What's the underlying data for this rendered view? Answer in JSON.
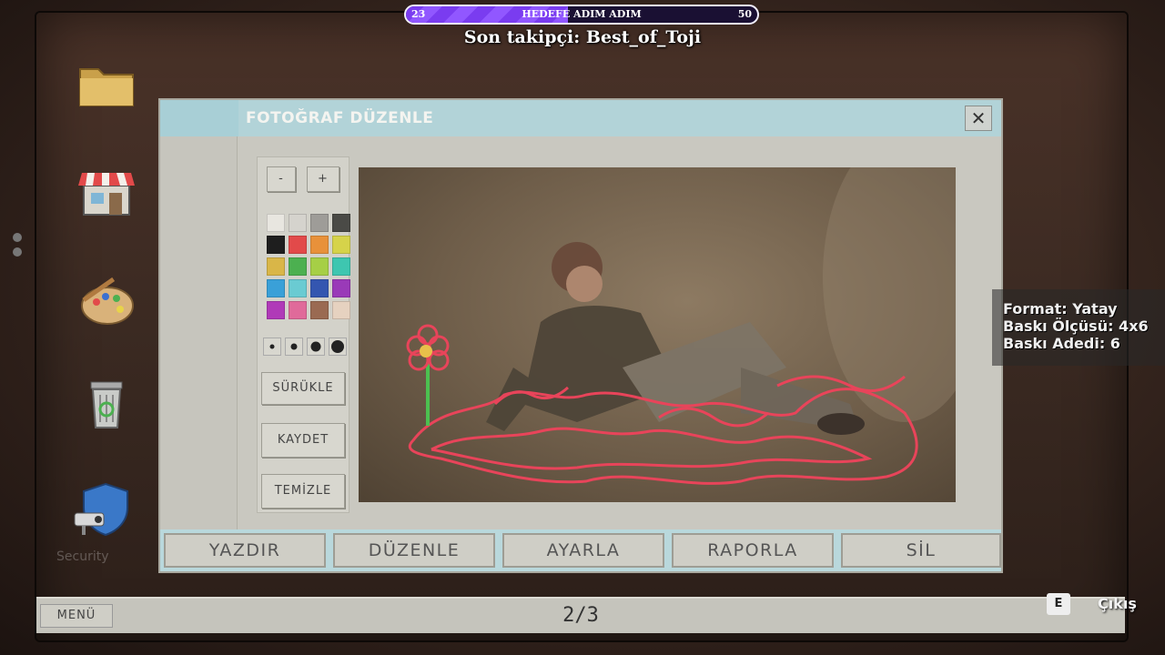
{
  "stream_overlay": {
    "goal": {
      "title": "HEDEFE ADIM ADIM",
      "current": "23",
      "target": "50",
      "progress": 0.46
    },
    "last_follower": "Son takipçi: Best_of_Toji"
  },
  "desktop": {
    "icons": [
      "folder-icon",
      "shop-icon",
      "paint-icon",
      "trash-icon",
      "security-icon"
    ],
    "security_label": "Security"
  },
  "window": {
    "title": "FOTOĞRAF DÜZENLE",
    "close_glyph": "✕",
    "tools": {
      "zoom_out": "-",
      "zoom_in": "+",
      "palette": [
        "#e8e6e0",
        "#d5d3cd",
        "#9e9c98",
        "#4a4a46",
        "#1e1e1e",
        "#e24a4a",
        "#e8913a",
        "#d6d34a",
        "#d9b648",
        "#4cb050",
        "#a6cf46",
        "#3ec6b0",
        "#3aa0d8",
        "#6acbd2",
        "#3456b0",
        "#9a3ab8",
        "#b03ab8",
        "#e06a9a",
        "#9a6a52",
        "#e6d2c0"
      ],
      "brush_sizes": [
        "xs",
        "s",
        "m",
        "l"
      ],
      "drag_label": "SÜRÜKLE",
      "save_label": "KAYDET",
      "clear_label": "TEMİZLE"
    },
    "actions": {
      "print": "YAZDIR",
      "edit": "DÜZENLE",
      "adjust": "AYARLA",
      "report": "RAPORLA",
      "delete": "SİL"
    }
  },
  "print_info": {
    "format": "Format: Yatay",
    "size": "Baskı Ölçüsü: 4x6",
    "count": "Baskı Adedi: 6"
  },
  "taskbar": {
    "menu_label": "MENÜ",
    "page": "2/3",
    "exit_key": "E",
    "exit_label": "Çıkış"
  }
}
